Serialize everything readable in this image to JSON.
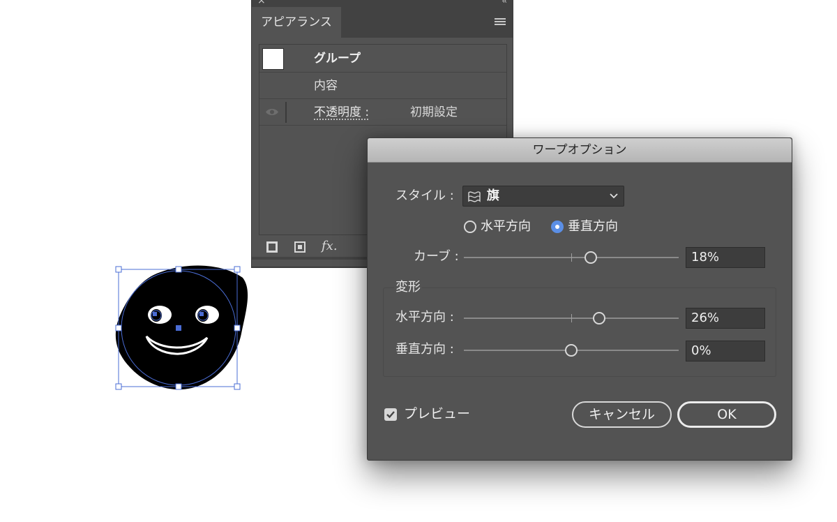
{
  "appearance_panel": {
    "tab_label": "アピアランス",
    "close_glyph": "×",
    "collapse_glyph": "‹‹",
    "rows": {
      "group_label": "グループ",
      "contents_label": "内容",
      "opacity_label": "不透明度 :",
      "opacity_value": "初期設定"
    },
    "bottom_icons": [
      "add-stroke-icon",
      "add-fill-icon",
      "fx-icon"
    ],
    "fx_label": "fx."
  },
  "warp_dialog": {
    "title": "ワープオプション",
    "style_label": "スタイル :",
    "style_value": "旗",
    "orientation_options": [
      "水平方向",
      "垂直方向"
    ],
    "orientation_selected": "垂直方向",
    "bend_label": "カーブ :",
    "bend_value": "18%",
    "bend_level": 0.18,
    "distortion_group_label": "変形",
    "horizontal_label": "水平方向 :",
    "horizontal_value": "26%",
    "horizontal_level": 0.26,
    "vertical_label": "垂直方向 :",
    "vertical_value": "0%",
    "vertical_level": 0.0,
    "preview_label": "プレビュー",
    "preview_checked": true,
    "cancel_label": "キャンセル",
    "ok_label": "OK"
  },
  "colors": {
    "panel_bg": "#535353",
    "selection_blue": "#4a6cd4",
    "radio_selected": "#5b8fe6"
  }
}
